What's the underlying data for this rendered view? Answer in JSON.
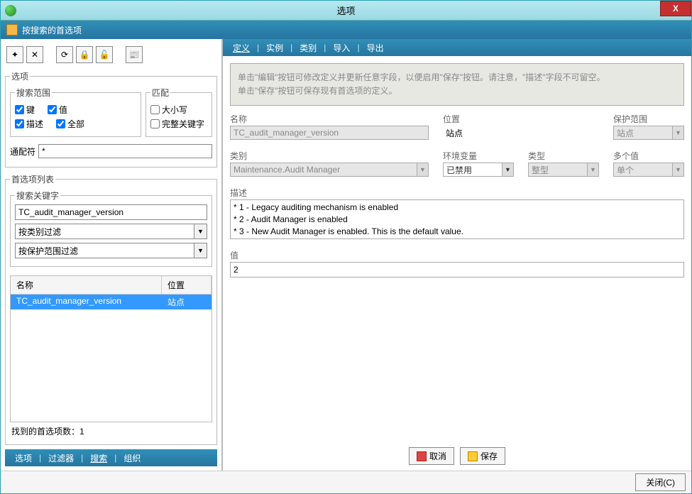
{
  "titlebar": {
    "title": "选项",
    "close": "X"
  },
  "subheader": {
    "title": "按搜索的首选项"
  },
  "toolbar_icons": {
    "new": "✦",
    "del": "✕",
    "a": "⟳",
    "b": "🔒",
    "c": "🔓",
    "d": "📰"
  },
  "options": {
    "legend": "选项",
    "scope": {
      "legend": "搜索范围",
      "key": "键",
      "value": "值",
      "desc": "描述",
      "all": "全部"
    },
    "match": {
      "legend": "匹配",
      "case": "大小写",
      "whole": "完整关键字"
    },
    "wildcard_label": "通配符",
    "wildcard_value": "*"
  },
  "preflist": {
    "legend": "首选项列表",
    "search_label": "搜索关键字",
    "keyword": "TC_audit_manager_version",
    "filter_category": "按类别过滤",
    "filter_scope": "按保护范围过滤",
    "columns": {
      "name": "名称",
      "loc": "位置"
    },
    "rows": [
      {
        "name": "TC_audit_manager_version",
        "loc": "站点"
      }
    ],
    "count": "找到的首选项数：1"
  },
  "bottomnav": {
    "options": "选项",
    "filters": "过滤器",
    "search": "搜索",
    "org": "组织"
  },
  "rtabs": {
    "def": "定义",
    "inst": "实例",
    "cat": "类别",
    "imp": "导入",
    "exp": "导出"
  },
  "help": {
    "line1": "单击\"编辑\"按钮可修改定义并更新任意字段，以便启用\"保存\"按钮。请注意，\"描述\"字段不可留空。",
    "line2": "单击\"保存\"按钮可保存现有首选项的定义。"
  },
  "form": {
    "name_label": "名称",
    "name_value": "TC_audit_manager_version",
    "loc_label": "位置",
    "loc_value": "站点",
    "scope_label": "保护范围",
    "scope_value": "站点",
    "cat_label": "类别",
    "cat_value": "Maintenance.Audit Manager",
    "env_label": "环境变量",
    "env_value": "已禁用",
    "type_label": "类型",
    "type_value": "整型",
    "multi_label": "多个值",
    "multi_value": "单个",
    "desc_label": "描述",
    "desc_lines": {
      "l1": "* 1 - Legacy auditing mechanism is enabled",
      "l2": "* 2 - Audit Manager is enabled",
      "l3": "* 3 - New Audit Manager is enabled. This is the default value."
    },
    "val_label": "值",
    "val_value": "2"
  },
  "actions": {
    "cancel": "取消",
    "save": "保存"
  },
  "footer": {
    "close": "关闭(C)"
  }
}
